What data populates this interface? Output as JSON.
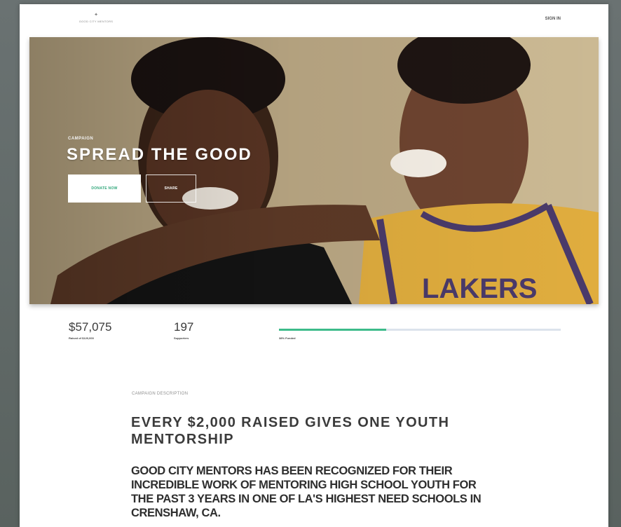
{
  "header": {
    "logo_text": "GOOD CITY MENTORS",
    "sign_in": "SIGN IN"
  },
  "hero": {
    "kicker": "CAMPAIGN",
    "title": "SPREAD THE GOOD",
    "donate_button": "DONATE NOW",
    "share_button": "SHARE"
  },
  "stats": {
    "amount": "$57,075",
    "amount_sub": "Raised of $120,000",
    "supporters": "197",
    "supporters_sub": "Supporters",
    "progress_label": "38% Funded",
    "progress_fraction": 0.38,
    "accent_color": "#3dbb8a"
  },
  "description": {
    "kicker": "CAMPAIGN DESCRIPTION",
    "heading": "EVERY $2,000 RAISED GIVES ONE YOUTH MENTORSHIP",
    "body": "GOOD CITY MENTORS HAS BEEN RECOGNIZED FOR THEIR INCREDIBLE WORK OF MENTORING HIGH SCHOOL YOUTH FOR THE PAST 3 YEARS IN ONE OF LA'S HIGHEST NEED SCHOOLS IN CRENSHAW, CA."
  }
}
